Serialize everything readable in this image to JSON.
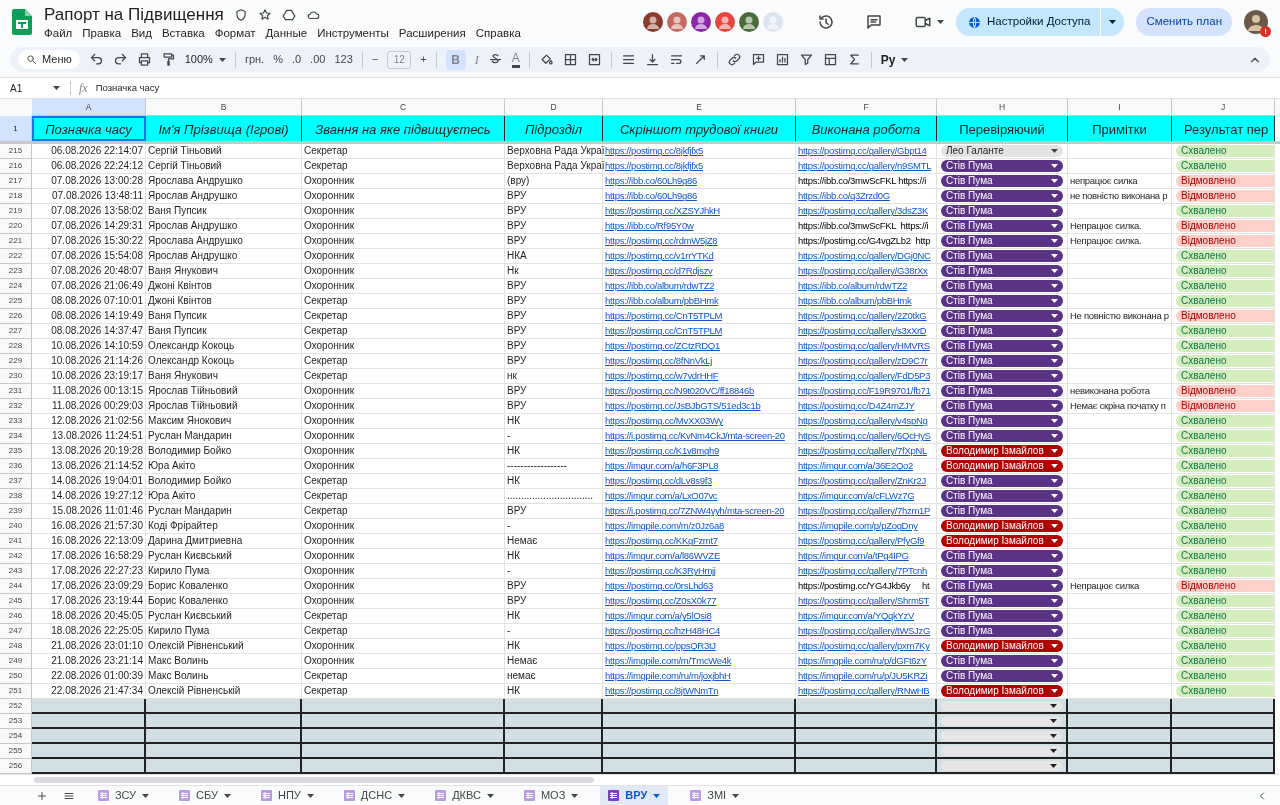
{
  "title": "Рапорт на Підвищення",
  "menu": [
    "Файл",
    "Правка",
    "Вид",
    "Вставка",
    "Формат",
    "Данные",
    "Инструменты",
    "Расширения",
    "Справка"
  ],
  "avatars": [
    {
      "color": "#8a3b2a"
    },
    {
      "color": "#c46b60"
    },
    {
      "color": "#8e24aa"
    },
    {
      "color": "#e8453c"
    },
    {
      "color": "#4a6b3a"
    },
    {
      "color": "#dbe4f0"
    }
  ],
  "share_button": "Настройки Доступа",
  "plan_button": "Сменить план",
  "profile_badge": "!",
  "toolbar": {
    "search": "Меню",
    "zoom": "100%",
    "currency": "грн.",
    "percent": "%",
    "dec_less": ".0",
    "dec_more": ".00",
    "number_format": "123",
    "minus": "−",
    "font_size": "12",
    "plus": "+",
    "bold": "B",
    "italic": "I",
    "text_color": "A",
    "input_tool": "Ру"
  },
  "formula_bar": {
    "cell_ref": "A1",
    "fx": "fx",
    "content": "Позначка часу"
  },
  "columns": [
    "A",
    "B",
    "C",
    "D",
    "E",
    "F",
    "H",
    "I",
    "J"
  ],
  "header_row": {
    "number": "1",
    "cells": [
      {
        "text": "Позначка часу",
        "italic": true
      },
      {
        "text": "Ім'я Прізвища (Ігрові)",
        "italic": true
      },
      {
        "text": "Звання на яке підвищуєтесь",
        "italic": true
      },
      {
        "text": "Підрозділ",
        "italic": true
      },
      {
        "text": "Скріншот трудової книги",
        "italic": true
      },
      {
        "text": "Виконана робота",
        "italic": true
      },
      {
        "text": "Перевіряючий",
        "italic": false
      },
      {
        "text": "Примітки",
        "italic": false
      },
      {
        "text": "Результат пер",
        "italic": false
      }
    ]
  },
  "rows": [
    {
      "n": "215",
      "time": "06.08.2026 22:14:07",
      "name": "Сергій Тіньовий",
      "rank": "Секретар",
      "unit": "Верховна Рада Украї",
      "screenshot": {
        "text": "https://postimg.cc/8jkfjfx5",
        "link": true
      },
      "work": {
        "text": "https://postimg.cc/gallery/Gbpt14",
        "link": true
      },
      "reviewer": {
        "text": "Лео Галанте",
        "color": "#e3e3e3"
      },
      "result": {
        "text": "Схвалено",
        "kind": "approved"
      }
    },
    {
      "n": "216",
      "time": "06.08.2026 22:24:12",
      "name": "Сергій Тіньовий",
      "rank": "Секретар",
      "unit": "Верховна Рада Украї",
      "screenshot": {
        "text": "https://postimg.cc/8jkfjfx5",
        "link": true
      },
      "work": {
        "text": "https://postimg.cc/gallery/n9SMTL",
        "link": true
      },
      "reviewer": {
        "text": "Стів Пума",
        "color": "#5a3286"
      },
      "result": {
        "text": "Схвалено",
        "kind": "approved"
      }
    },
    {
      "n": "217",
      "time": "07.08.2026 13:00:28",
      "name": "Ярослава Андрушко",
      "rank": "Охоронник",
      "unit": "(вру)",
      "screenshot": {
        "text": "https://ibb.co/60Lh9g86",
        "link": true
      },
      "work": {
        "text": "https://ibb.co/3mwScFKL https://i",
        "link": false
      },
      "reviewer": {
        "text": "Стів Пума",
        "color": "#5a3286"
      },
      "note": "непрацює силка",
      "result": {
        "text": "Відмовлено",
        "kind": "rejected"
      }
    },
    {
      "n": "218",
      "time": "07.08.2026 13:48:11",
      "name": "Ярослав Андрушко",
      "rank": "Охоронник",
      "unit": "ВРУ",
      "screenshot": {
        "text": "https://ibb.co/60Lh9g86",
        "link": true
      },
      "work": {
        "text": "https://ibb.co/q3Zrzd0G",
        "link": true
      },
      "reviewer": {
        "text": "Стів Пума",
        "color": "#5a3286"
      },
      "note": "не повністю виконана р",
      "result": {
        "text": "Відмовлено",
        "kind": "rejected"
      }
    },
    {
      "n": "219",
      "time": "07.08.2026 13:58:02",
      "name": "Ваня Пупсик",
      "rank": "Охоронник",
      "unit": "ВРУ",
      "screenshot": {
        "text": "https://postimg.cc/XZSYJhkH",
        "link": true
      },
      "work": {
        "text": "https://postimg.cc/gallery/3dsZ3K",
        "link": true
      },
      "reviewer": {
        "text": "Стів Пума",
        "color": "#5a3286"
      },
      "result": {
        "text": "Схвалено",
        "kind": "approved"
      }
    },
    {
      "n": "220",
      "time": "07.08.2026 14:29:31",
      "name": "Ярослав Андрушко",
      "rank": "Охоронник",
      "unit": "ВРУ",
      "screenshot": {
        "text": "https://ibb.co/Rf95Y0w",
        "link": true
      },
      "work": {
        "text": "https://ibb.co/3mwScFKL  https://i",
        "link": false
      },
      "reviewer": {
        "text": "Стів Пума",
        "color": "#5a3286"
      },
      "note": "Непрацює силка.",
      "result": {
        "text": "Відмовлено",
        "kind": "rejected"
      }
    },
    {
      "n": "221",
      "time": "07.08.2026 15:30:22",
      "name": "Ярослава Андрушко",
      "rank": "Охоронник",
      "unit": "ВРУ",
      "screenshot": {
        "text": "https://postimg.cc/rdmW5jZ8",
        "link": true
      },
      "work": {
        "text": "https://postimg.cc/G4vgZLb2  http",
        "link": false
      },
      "reviewer": {
        "text": "Стів Пума",
        "color": "#5a3286"
      },
      "note": "Непрацює силка.",
      "result": {
        "text": "Відмовлено",
        "kind": "rejected"
      }
    },
    {
      "n": "222",
      "time": "07.08.2026 15:54:08",
      "name": "Ярослав Андрушко",
      "rank": "Охоронник",
      "unit": "НКА",
      "screenshot": {
        "text": "https://postimg.cc/v1rrYTKd",
        "link": true
      },
      "work": {
        "text": "https://postimg.cc/gallery/DGj0NC",
        "link": true
      },
      "reviewer": {
        "text": "Стів Пума",
        "color": "#5a3286"
      },
      "result": {
        "text": "Схвалено",
        "kind": "approved"
      }
    },
    {
      "n": "223",
      "time": "07.08.2026 20:48:07",
      "name": "Ваня Янукович",
      "rank": "Охоронник",
      "unit": "Нк",
      "screenshot": {
        "text": "https://postimg.cc/d7Rdjszv",
        "link": true
      },
      "work": {
        "text": "https://postimg.cc/gallery/G38rXx",
        "link": true
      },
      "reviewer": {
        "text": "Стів Пума",
        "color": "#5a3286"
      },
      "result": {
        "text": "Схвалено",
        "kind": "approved"
      }
    },
    {
      "n": "224",
      "time": "07.08.2026 21:06:49",
      "name": "Джоні Квінтов",
      "rank": "Охоронник",
      "unit": "ВРУ",
      "screenshot": {
        "text": "https://ibb.co/album/rdwTZ2",
        "link": true
      },
      "work": {
        "text": "https://ibb.co/album/rdwTZ2",
        "link": true
      },
      "reviewer": {
        "text": "Стів Пума",
        "color": "#5a3286"
      },
      "result": {
        "text": "Схвалено",
        "kind": "approved"
      }
    },
    {
      "n": "225",
      "time": "08.08.2026 07:10:01",
      "name": "Джоні Квінтов",
      "rank": "Секретар",
      "unit": "ВРУ",
      "screenshot": {
        "text": "https://ibb.co/album/pbBHmk",
        "link": true
      },
      "work": {
        "text": "https://ibb.co/album/pbBHmk",
        "link": true
      },
      "reviewer": {
        "text": "Стів Пума",
        "color": "#5a3286"
      },
      "result": {
        "text": "Схвалено",
        "kind": "approved"
      }
    },
    {
      "n": "226",
      "time": "08.08.2026 14:19:49",
      "name": "Ваня Пупсик",
      "rank": "Секретар",
      "unit": "ВРУ",
      "screenshot": {
        "text": "https://postimg.cc/CnT5TPLM",
        "link": true
      },
      "work": {
        "text": "https://postimg.cc/gallery/2Z0tkG",
        "link": true
      },
      "reviewer": {
        "text": "Стів Пума",
        "color": "#5a3286"
      },
      "note": "Не повністю виконана р",
      "result": {
        "text": "Відмовлено",
        "kind": "rejected"
      }
    },
    {
      "n": "227",
      "time": "08.08.2026 14:37:47",
      "name": "Ваня Пупсик",
      "rank": "Секретар",
      "unit": "ВРУ",
      "screenshot": {
        "text": "https://postimg.cc/CnT5TPLM",
        "link": true
      },
      "work": {
        "text": "https://postimg.cc/gallery/s3xXrD",
        "link": true
      },
      "reviewer": {
        "text": "Стів Пума",
        "color": "#5a3286"
      },
      "result": {
        "text": "Схвалено",
        "kind": "approved"
      }
    },
    {
      "n": "228",
      "time": "10.08.2026 14:10:59",
      "name": "Олександр Кокоць",
      "rank": "Охоронник",
      "unit": "ВРУ",
      "screenshot": {
        "text": "https://postimg.cc/ZCtzRDQ1",
        "link": true
      },
      "work": {
        "text": "https://postimg.cc/gallery/HMVRS",
        "link": true
      },
      "reviewer": {
        "text": "Стів Пума",
        "color": "#5a3286"
      },
      "result": {
        "text": "Схвалено",
        "kind": "approved"
      }
    },
    {
      "n": "229",
      "time": "10.08.2026 21:14:26",
      "name": "Олександр Кокоць",
      "rank": "Секретар",
      "unit": "ВРУ",
      "screenshot": {
        "text": "https://postimg.cc/8fNnVkLj",
        "link": true
      },
      "work": {
        "text": "https://postimg.cc/gallery/zD9C7r",
        "link": true
      },
      "reviewer": {
        "text": "Стів Пума",
        "color": "#5a3286"
      },
      "result": {
        "text": "Схвалено",
        "kind": "approved"
      }
    },
    {
      "n": "230",
      "time": "10.08.2026 23:19:17",
      "name": "Ваня Янукович",
      "rank": "Секретар",
      "unit": "нк",
      "screenshot": {
        "text": "https://postimg.cc/w7vdrHHF",
        "link": true
      },
      "work": {
        "text": "https://postimg.cc/gallery/FdD5P3",
        "link": true
      },
      "reviewer": {
        "text": "Стів Пума",
        "color": "#5a3286"
      },
      "result": {
        "text": "Схвалено",
        "kind": "approved"
      }
    },
    {
      "n": "231",
      "time": "11.08.2026 00:13:15",
      "name": "Ярослав Тійньовий",
      "rank": "Охоронник",
      "unit": "ВРУ",
      "screenshot": {
        "text": "https://postimg.cc/N9t020VC/ff18846b",
        "link": true
      },
      "work": {
        "text": "https://postimg.cc/F19R9701/fb71",
        "link": true
      },
      "reviewer": {
        "text": "Стів Пума",
        "color": "#5a3286"
      },
      "note": "невиконана робота",
      "result": {
        "text": "Відмовлено",
        "kind": "rejected"
      }
    },
    {
      "n": "232",
      "time": "11.08.2026 00:29:03",
      "name": "Ярослав Тійньовий",
      "rank": "Охоронник",
      "unit": "ВРУ",
      "screenshot": {
        "text": "https://postimg.cc/JsBJbGTS/51ed3c1b",
        "link": true
      },
      "work": {
        "text": "https://postimg.cc/D4Z4mZJY",
        "link": true
      },
      "reviewer": {
        "text": "Стів Пума",
        "color": "#5a3286"
      },
      "note": "Немає скріна початку п",
      "result": {
        "text": "Відмовлено",
        "kind": "rejected"
      }
    },
    {
      "n": "233",
      "time": "12.08.2026 21:02:56",
      "name": "Максим Янокович",
      "rank": "Охоронник",
      "unit": "НК",
      "screenshot": {
        "text": "https://postimg.cc/MvXX03Wy",
        "link": true
      },
      "work": {
        "text": "https://postimg.cc/gallery/v4spNg",
        "link": true
      },
      "reviewer": {
        "text": "Стів Пума",
        "color": "#5a3286"
      },
      "result": {
        "text": "Схвалено",
        "kind": "approved"
      }
    },
    {
      "n": "234",
      "time": "13.08.2026 11:24:51",
      "name": "Руслан Мандарин",
      "rank": "Охоронник",
      "unit": "-",
      "screenshot": {
        "text": "https://i.postimg.cc/KvNm4CkJ/mta-screen-20",
        "link": true
      },
      "work": {
        "text": "https://postimg.cc/gallery/6QcHyS",
        "link": true
      },
      "reviewer": {
        "text": "Стів Пума",
        "color": "#5a3286"
      },
      "result": {
        "text": "Схвалено",
        "kind": "approved"
      }
    },
    {
      "n": "235",
      "time": "13.08.2026 20:19:28",
      "name": "Володимир Бойко",
      "rank": "Охоронник",
      "unit": "НК",
      "screenshot": {
        "text": "https://postimg.cc/K1v8mgh9",
        "link": true
      },
      "work": {
        "text": "https://postimg.cc/gallery/7fXpNL",
        "link": true
      },
      "reviewer": {
        "text": "Володимир Ізмайлов",
        "color": "#b10202"
      },
      "result": {
        "text": "Схвалено",
        "kind": "approved"
      }
    },
    {
      "n": "236",
      "time": "13.08.2026 21:14:52",
      "name": "Юра Акіто",
      "rank": "Охоронник",
      "unit": "------------------",
      "screenshot": {
        "text": "https://imgur.com/a/h6F3PL8",
        "link": true
      },
      "work": {
        "text": "https://imgur.com/a/36E2Qo2",
        "link": true
      },
      "reviewer": {
        "text": "Володимир Ізмайлов",
        "color": "#b10202"
      },
      "result": {
        "text": "Схвалено",
        "kind": "approved"
      }
    },
    {
      "n": "237",
      "time": "14.08.2026 19:04:01",
      "name": "Володимир Бойко",
      "rank": "Секретар",
      "unit": "НК",
      "screenshot": {
        "text": "https://postimg.cc/dLv8s9f3",
        "link": true
      },
      "work": {
        "text": "https://postimg.cc/gallery/ZnKr2J",
        "link": true
      },
      "reviewer": {
        "text": "Стів Пума",
        "color": "#5a3286"
      },
      "result": {
        "text": "Схвалено",
        "kind": "approved"
      }
    },
    {
      "n": "238",
      "time": "14.08.2026 19:27:12",
      "name": "Юра Акіто",
      "rank": "Секретар",
      "unit": "...............................",
      "screenshot": {
        "text": "https://imgur.com/a/LxO07vc",
        "link": true
      },
      "work": {
        "text": "https://imgur.com/a/cFLWz7G",
        "link": true
      },
      "reviewer": {
        "text": "Стів Пума",
        "color": "#5a3286"
      },
      "result": {
        "text": "Схвалено",
        "kind": "approved"
      }
    },
    {
      "n": "239",
      "time": "15.08.2026 11:01:46",
      "name": "Руслан Мандарин",
      "rank": "Секретар",
      "unit": "ВРУ",
      "screenshot": {
        "text": "https://i.postimg.cc/7ZNW4yyh/mta-screen-20",
        "link": true
      },
      "work": {
        "text": "https://postimg.cc/gallery/7hzm1P",
        "link": true
      },
      "reviewer": {
        "text": "Стів Пума",
        "color": "#5a3286"
      },
      "result": {
        "text": "Схвалено",
        "kind": "approved"
      }
    },
    {
      "n": "240",
      "time": "16.08.2026 21:57:30",
      "name": "Коді Фрірайтер",
      "rank": "Охоронник",
      "unit": "-",
      "screenshot": {
        "text": "https://imgpile.com/m/z0Jz6a8",
        "link": true
      },
      "work": {
        "text": "https://imgpile.com/p/pZogDny",
        "link": true
      },
      "reviewer": {
        "text": "Володимир Ізмайлов",
        "color": "#b10202"
      },
      "result": {
        "text": "Схвалено",
        "kind": "approved"
      }
    },
    {
      "n": "241",
      "time": "16.08.2026 22:13:09",
      "name": "Дарина Дмитриевна",
      "rank": "Охоронник",
      "unit": "Немає",
      "screenshot": {
        "text": "https://postimg.cc/KKgFzmt7",
        "link": true
      },
      "work": {
        "text": "https://postimg.cc/gallery/PfyGf9",
        "link": true
      },
      "reviewer": {
        "text": "Володимир Ізмайлов",
        "color": "#b10202"
      },
      "result": {
        "text": "Схвалено",
        "kind": "approved"
      }
    },
    {
      "n": "242",
      "time": "17.08.2026 16:58:29",
      "name": "Руслан Києвський",
      "rank": "Охоронник",
      "unit": "НК",
      "screenshot": {
        "text": "https://imgur.com/a/l86WVZE",
        "link": true
      },
      "work": {
        "text": "https://imgur.com/a/tPg4IPG",
        "link": true
      },
      "reviewer": {
        "text": "Стів Пума",
        "color": "#5a3286"
      },
      "result": {
        "text": "Схвалено",
        "kind": "approved"
      }
    },
    {
      "n": "243",
      "time": "17.08.2026 22:27:23",
      "name": "Кирило Пума",
      "rank": "Охоронник",
      "unit": "-",
      "screenshot": {
        "text": "https://postimg.cc/K3RyHmjj",
        "link": true
      },
      "work": {
        "text": "https://postimg.cc/gallery/7PTcnh",
        "link": true
      },
      "reviewer": {
        "text": "Стів Пума",
        "color": "#5a3286"
      },
      "result": {
        "text": "Схвалено",
        "kind": "approved"
      }
    },
    {
      "n": "244",
      "time": "17.08.2026 23:09:29",
      "name": "Борис Коваленко",
      "rank": "Охоронник",
      "unit": "ВРУ",
      "screenshot": {
        "text": "https://postimg.cc/0rsLhd63",
        "link": true
      },
      "work": {
        "text": "https://postimg.cc/YG4Jkb6y     ht",
        "link": false
      },
      "reviewer": {
        "text": "Стів Пума",
        "color": "#5a3286"
      },
      "note": "Непрацює силка",
      "result": {
        "text": "Відмовлено",
        "kind": "rejected"
      }
    },
    {
      "n": "245",
      "time": "17.08.2026 23:19:44",
      "name": "Борис Коваленко",
      "rank": "Охоронник",
      "unit": "ВРУ",
      "screenshot": {
        "text": "https://postimg.cc/Z0sX0k77",
        "link": true
      },
      "work": {
        "text": "https://postimg.cc/gallery/Shrm5T",
        "link": true
      },
      "reviewer": {
        "text": "Стів Пума",
        "color": "#5a3286"
      },
      "result": {
        "text": "Схвалено",
        "kind": "approved"
      }
    },
    {
      "n": "246",
      "time": "18.08.2026 20:45:05",
      "name": "Руслан Києвський",
      "rank": "Секретар",
      "unit": "НК",
      "screenshot": {
        "text": "https://imgur.com/a/y5lOsi8",
        "link": true
      },
      "work": {
        "text": "https://imgur.com/a/YQqkYzV",
        "link": true
      },
      "reviewer": {
        "text": "Стів Пума",
        "color": "#5a3286"
      },
      "result": {
        "text": "Схвалено",
        "kind": "approved"
      }
    },
    {
      "n": "247",
      "time": "18.08.2026 22:25:05",
      "name": "Кирило Пума",
      "rank": "Секретар",
      "unit": "-",
      "screenshot": {
        "text": "https://postimg.cc/hzH48HC4",
        "link": true
      },
      "work": {
        "text": "https://postimg.cc/gallery/tWSJzG",
        "link": true
      },
      "reviewer": {
        "text": "Стів Пума",
        "color": "#5a3286"
      },
      "result": {
        "text": "Схвалено",
        "kind": "approved"
      }
    },
    {
      "n": "248",
      "time": "21.08.2026 23:01:10",
      "name": "Олексій Рівненський",
      "rank": "Охоронник",
      "unit": "НК",
      "screenshot": {
        "text": "https://postimg.cc/ppsQR3tJ",
        "link": true
      },
      "work": {
        "text": "https://postimg.cc/gallery/pxm7Ky",
        "link": true
      },
      "reviewer": {
        "text": "Володимир Ізмайлов",
        "color": "#b10202"
      },
      "result": {
        "text": "Схвалено",
        "kind": "approved"
      }
    },
    {
      "n": "249",
      "time": "21.08.2026 23:21:14",
      "name": "Макс Волинь",
      "rank": "Охоронник",
      "unit": "Немає",
      "screenshot": {
        "text": "https://imgpile.com/m/TmcWe4k",
        "link": true
      },
      "work": {
        "text": "https://imgpile.com/ru/p/dGFt6zY",
        "link": true
      },
      "reviewer": {
        "text": "Стів Пума",
        "color": "#5a3286"
      },
      "result": {
        "text": "Схвалено",
        "kind": "approved"
      }
    },
    {
      "n": "250",
      "time": "22.08.2026 01:00:39",
      "name": "Макс Волинь",
      "rank": "Секретар",
      "unit": "немає",
      "screenshot": {
        "text": "https://imgpile.com/ru/m/joxjbhH",
        "link": true
      },
      "work": {
        "text": "https://imgpile.com/ru/p/JU5KRZi",
        "link": true
      },
      "reviewer": {
        "text": "Стів Пума",
        "color": "#5a3286"
      },
      "result": {
        "text": "Схвалено",
        "kind": "approved"
      }
    },
    {
      "n": "251",
      "time": "22.08.2026 21:47:34",
      "name": "Олексій Рівненській",
      "rank": "Секретар",
      "unit": "НК",
      "screenshot": {
        "text": "https://postimg.cc/8jtWNmTn",
        "link": true
      },
      "work": {
        "text": "https://postimg.cc/gallery/RNwHB",
        "link": true
      },
      "reviewer": {
        "text": "Володимир Ізмайлов",
        "color": "#b10202"
      },
      "result": {
        "text": "Схвалено",
        "kind": "approved"
      }
    }
  ],
  "empty_rows": [
    "252",
    "253",
    "254",
    "255",
    "256"
  ],
  "sheets": [
    {
      "label": "ЗСУ",
      "selected": false
    },
    {
      "label": "СБУ",
      "selected": false
    },
    {
      "label": "НПУ",
      "selected": false
    },
    {
      "label": "ДСНС",
      "selected": false
    },
    {
      "label": "ДКВС",
      "selected": false
    },
    {
      "label": "МОЗ",
      "selected": false
    },
    {
      "label": "ВРУ",
      "selected": true
    },
    {
      "label": "ЗМІ",
      "selected": false
    }
  ]
}
